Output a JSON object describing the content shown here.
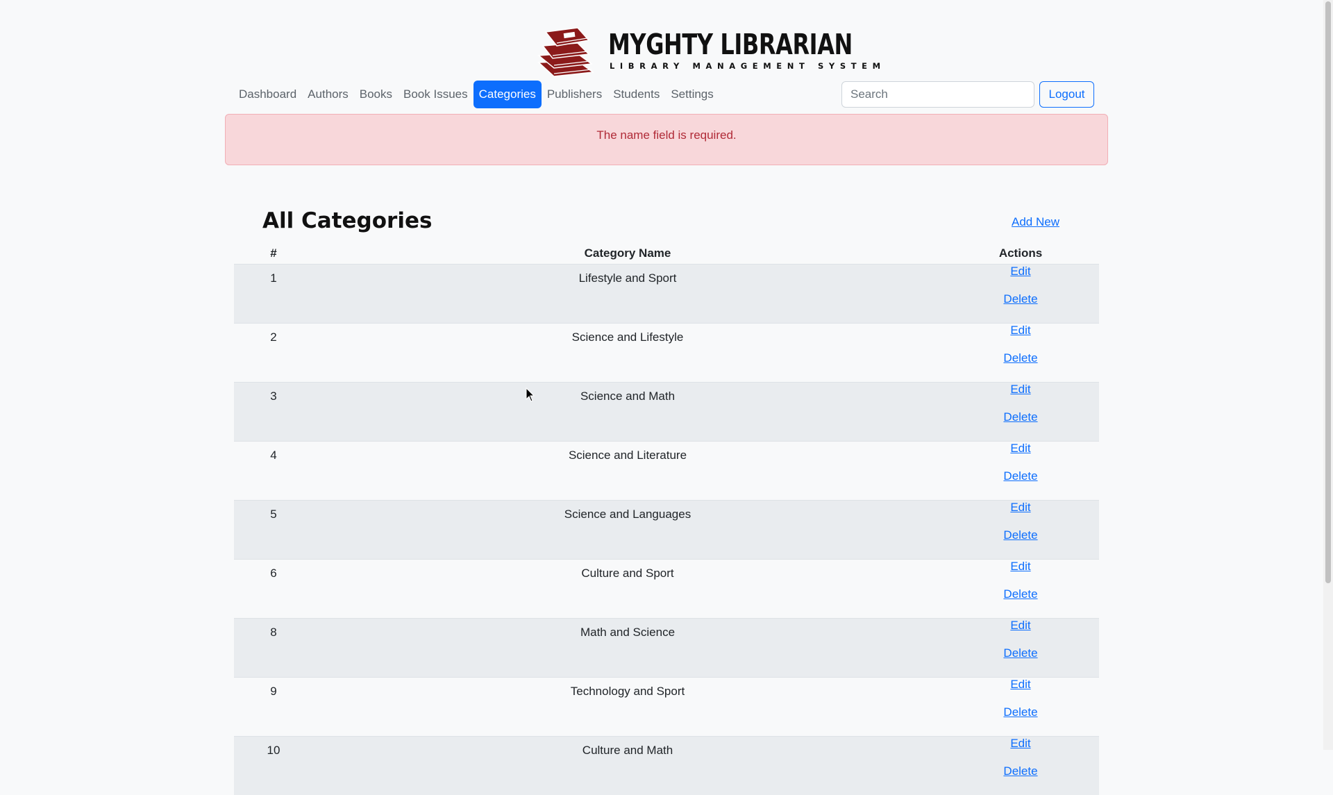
{
  "brand": {
    "title": "MYGHTY LIBRARIAN",
    "subtitle": "LIBRARY MANAGEMENT SYSTEM"
  },
  "nav": {
    "items": [
      {
        "label": "Dashboard"
      },
      {
        "label": "Authors"
      },
      {
        "label": "Books"
      },
      {
        "label": "Book Issues"
      },
      {
        "label": "Categories",
        "active": true
      },
      {
        "label": "Publishers"
      },
      {
        "label": "Students"
      },
      {
        "label": "Settings"
      }
    ],
    "search_placeholder": "Search",
    "logout_label": "Logout"
  },
  "alert": {
    "message": "The name field is required."
  },
  "page": {
    "title": "All Categories",
    "add_new_label": "Add New"
  },
  "table": {
    "headers": {
      "num": "#",
      "name": "Category Name",
      "actions": "Actions"
    },
    "rows": [
      {
        "num": "1",
        "name": "Lifestyle and Sport",
        "edit": "Edit",
        "delete": "Delete"
      },
      {
        "num": "2",
        "name": "Science and Lifestyle",
        "edit": "Edit",
        "delete": "Delete"
      },
      {
        "num": "3",
        "name": "Science and Math",
        "edit": "Edit",
        "delete": "Delete"
      },
      {
        "num": "4",
        "name": "Science and Literature",
        "edit": "Edit",
        "delete": "Delete"
      },
      {
        "num": "5",
        "name": "Science and Languages",
        "edit": "Edit",
        "delete": "Delete"
      },
      {
        "num": "6",
        "name": "Culture and Sport",
        "edit": "Edit",
        "delete": "Delete"
      },
      {
        "num": "8",
        "name": "Math and Science",
        "edit": "Edit",
        "delete": "Delete"
      },
      {
        "num": "9",
        "name": "Technology and Sport",
        "edit": "Edit",
        "delete": "Delete"
      },
      {
        "num": "10",
        "name": "Culture and Math",
        "edit": "Edit",
        "delete": "Delete"
      }
    ]
  },
  "colors": {
    "primary": "#0d6efd",
    "alert_bg": "#f8d7da",
    "alert_text": "#b02a37",
    "logo": "#8b1a1a"
  },
  "icons": {
    "logo": "books-stack-icon",
    "cursor": "mouse-pointer-icon"
  }
}
